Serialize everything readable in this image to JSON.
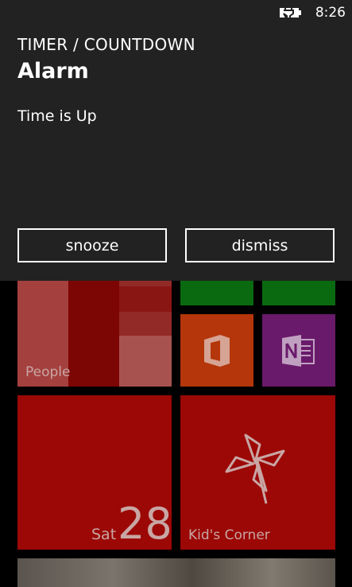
{
  "status_bar": {
    "time": "8:26",
    "battery_icon": "battery-charging-icon"
  },
  "notification": {
    "app_name": "TIMER / COUNTDOWN",
    "title": "Alarm",
    "message": "Time is Up",
    "buttons": {
      "snooze_label": "snooze",
      "dismiss_label": "dismiss"
    }
  },
  "tiles": {
    "people_label": "People",
    "office_icon": "office-icon",
    "onenote_icon": "onenote-icon",
    "calendar": {
      "day": "Sat",
      "date": "28"
    },
    "kids_corner_label": "Kid's Corner",
    "kids_corner_icon": "pinwheel-icon"
  },
  "colors": {
    "banner_bg": "#222222",
    "tile_red": "#9c0806",
    "tile_green": "#0a6a10",
    "tile_orange": "#b4360a",
    "tile_purple": "#6a1a6a"
  }
}
